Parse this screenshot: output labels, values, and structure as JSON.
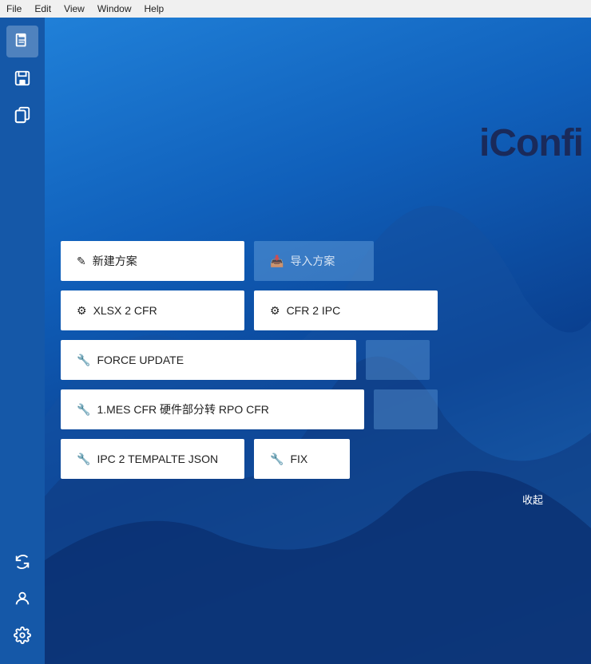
{
  "menubar": {
    "items": [
      "File",
      "Edit",
      "View",
      "Window",
      "Help"
    ]
  },
  "sidebar": {
    "icons": [
      {
        "name": "document-icon",
        "symbol": "🗎",
        "active": true
      },
      {
        "name": "save-icon",
        "symbol": "💾",
        "active": false
      },
      {
        "name": "copy-icon",
        "symbol": "🗐",
        "active": false
      }
    ],
    "bottom_icons": [
      {
        "name": "refresh-icon",
        "symbol": "↺"
      },
      {
        "name": "user-icon",
        "symbol": "👤"
      },
      {
        "name": "settings-icon",
        "symbol": "⚙"
      }
    ]
  },
  "app": {
    "title": "iConfi"
  },
  "buttons": {
    "new_plan": "✎ 新建方案",
    "import_plan": "📥 导入方案",
    "xlsx_to_cfr": "XLSX 2 CFR",
    "cfr_to_ipc": "CFR 2 IPC",
    "force_update": "FORCE UPDATE",
    "btn5_placeholder": "",
    "mes_cfr": "1.MES CFR 硬件部分转 RPO CFR",
    "btn6_placeholder": "",
    "ipc_template": "IPC 2 TEMPALTE JSON",
    "fix": "FIX",
    "collapse": "收起",
    "wrench_icon": "🔧"
  }
}
